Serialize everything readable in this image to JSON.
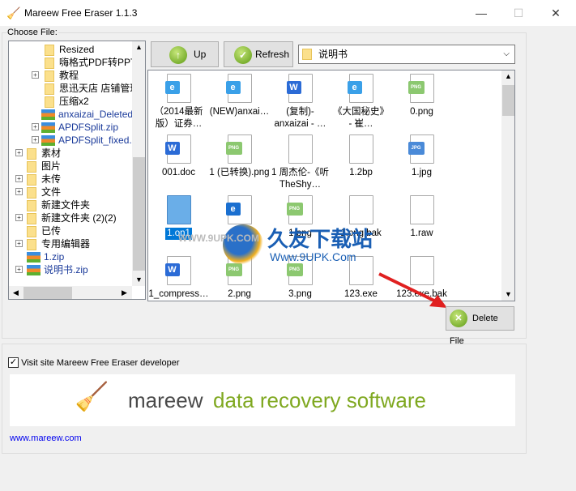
{
  "window": {
    "title": "Mareew Free Eraser 1.1.3",
    "minimize": "—",
    "maximize": "☐",
    "close": "✕"
  },
  "choose_file_label": "Choose File:",
  "tree": [
    {
      "label": "Resized",
      "type": "folder",
      "level": 2,
      "expandable": false
    },
    {
      "label": "嗨格式PDF转PPT",
      "type": "folder",
      "level": 2,
      "expandable": false
    },
    {
      "label": "教程",
      "type": "folder",
      "level": 2,
      "expandable": true
    },
    {
      "label": "思迅天店 店铺管理",
      "type": "folder",
      "level": 2,
      "expandable": false
    },
    {
      "label": "压缩x2",
      "type": "folder",
      "level": 2,
      "expandable": false
    },
    {
      "label": "anxaizai_Deleted.zip",
      "type": "zip",
      "level": 2,
      "expandable": false
    },
    {
      "label": "APDFSplit.zip",
      "type": "zip",
      "level": 2,
      "expandable": true
    },
    {
      "label": "APDFSplit_fixed.zip",
      "type": "zip",
      "level": 2,
      "expandable": true
    },
    {
      "label": "素材",
      "type": "folder",
      "level": 1,
      "expandable": true
    },
    {
      "label": "图片",
      "type": "folder",
      "level": 1,
      "expandable": false
    },
    {
      "label": "未传",
      "type": "folder",
      "level": 1,
      "expandable": true
    },
    {
      "label": "文件",
      "type": "folder",
      "level": 1,
      "expandable": true
    },
    {
      "label": "新建文件夹",
      "type": "folder",
      "level": 1,
      "expandable": false
    },
    {
      "label": "新建文件夹 (2)(2)",
      "type": "folder",
      "level": 1,
      "expandable": true
    },
    {
      "label": "已传",
      "type": "folder",
      "level": 1,
      "expandable": false
    },
    {
      "label": "专用编辑器",
      "type": "folder",
      "level": 1,
      "expandable": true
    },
    {
      "label": "1.zip",
      "type": "zip",
      "level": 1,
      "expandable": false
    },
    {
      "label": "说明书.zip",
      "type": "zip",
      "level": 1,
      "expandable": true
    }
  ],
  "toolbar": {
    "up": "Up",
    "refresh": "Refresh",
    "folder_combo": "说明书"
  },
  "files": [
    {
      "name": "（2014最新版）证券…",
      "icon": "edge-doc"
    },
    {
      "name": "(NEW)anxai…",
      "icon": "edge-doc"
    },
    {
      "name": "(复制)-anxaizai - …",
      "icon": "word-doc"
    },
    {
      "name": "《大国秘史》 - 崔…",
      "icon": "edge-doc"
    },
    {
      "name": "0.png",
      "icon": "png"
    },
    {
      "name": "001.doc",
      "icon": "word-doc"
    },
    {
      "name": "1 (已转换).png",
      "icon": "png"
    },
    {
      "name": "1 周杰伦-《听TheShy…",
      "icon": "blank"
    },
    {
      "name": "1.2bp",
      "icon": "blank"
    },
    {
      "name": "1.jpg",
      "icon": "jpg"
    },
    {
      "name": "1.on1",
      "icon": "blue-doc",
      "selected": true
    },
    {
      "name": "1.pdf",
      "icon": "ie-pdf"
    },
    {
      "name": "1.png",
      "icon": "png"
    },
    {
      "name": "1.png.bak",
      "icon": "blank"
    },
    {
      "name": "1.raw",
      "icon": "blank"
    },
    {
      "name": "1_compress…",
      "icon": "word-doc"
    },
    {
      "name": "2.png",
      "icon": "png"
    },
    {
      "name": "3.png",
      "icon": "png"
    },
    {
      "name": "123.exe",
      "icon": "exe"
    },
    {
      "name": "123.exe.bak",
      "icon": "blank"
    }
  ],
  "watermark": {
    "cn": "久友下载站",
    "url": "Www.9UPK.Com",
    "small": "WWW.9UPK.COM"
  },
  "delete_button": "Delete File",
  "visit_checkbox": {
    "label": "Visit site Mareew Free Eraser developer",
    "checked": true
  },
  "banner": {
    "brand": "mareew",
    "tagline": "data recovery software",
    "brand_color": "#4a4a4a",
    "tagline_color": "#7fa820"
  },
  "link": "www.mareew.com"
}
